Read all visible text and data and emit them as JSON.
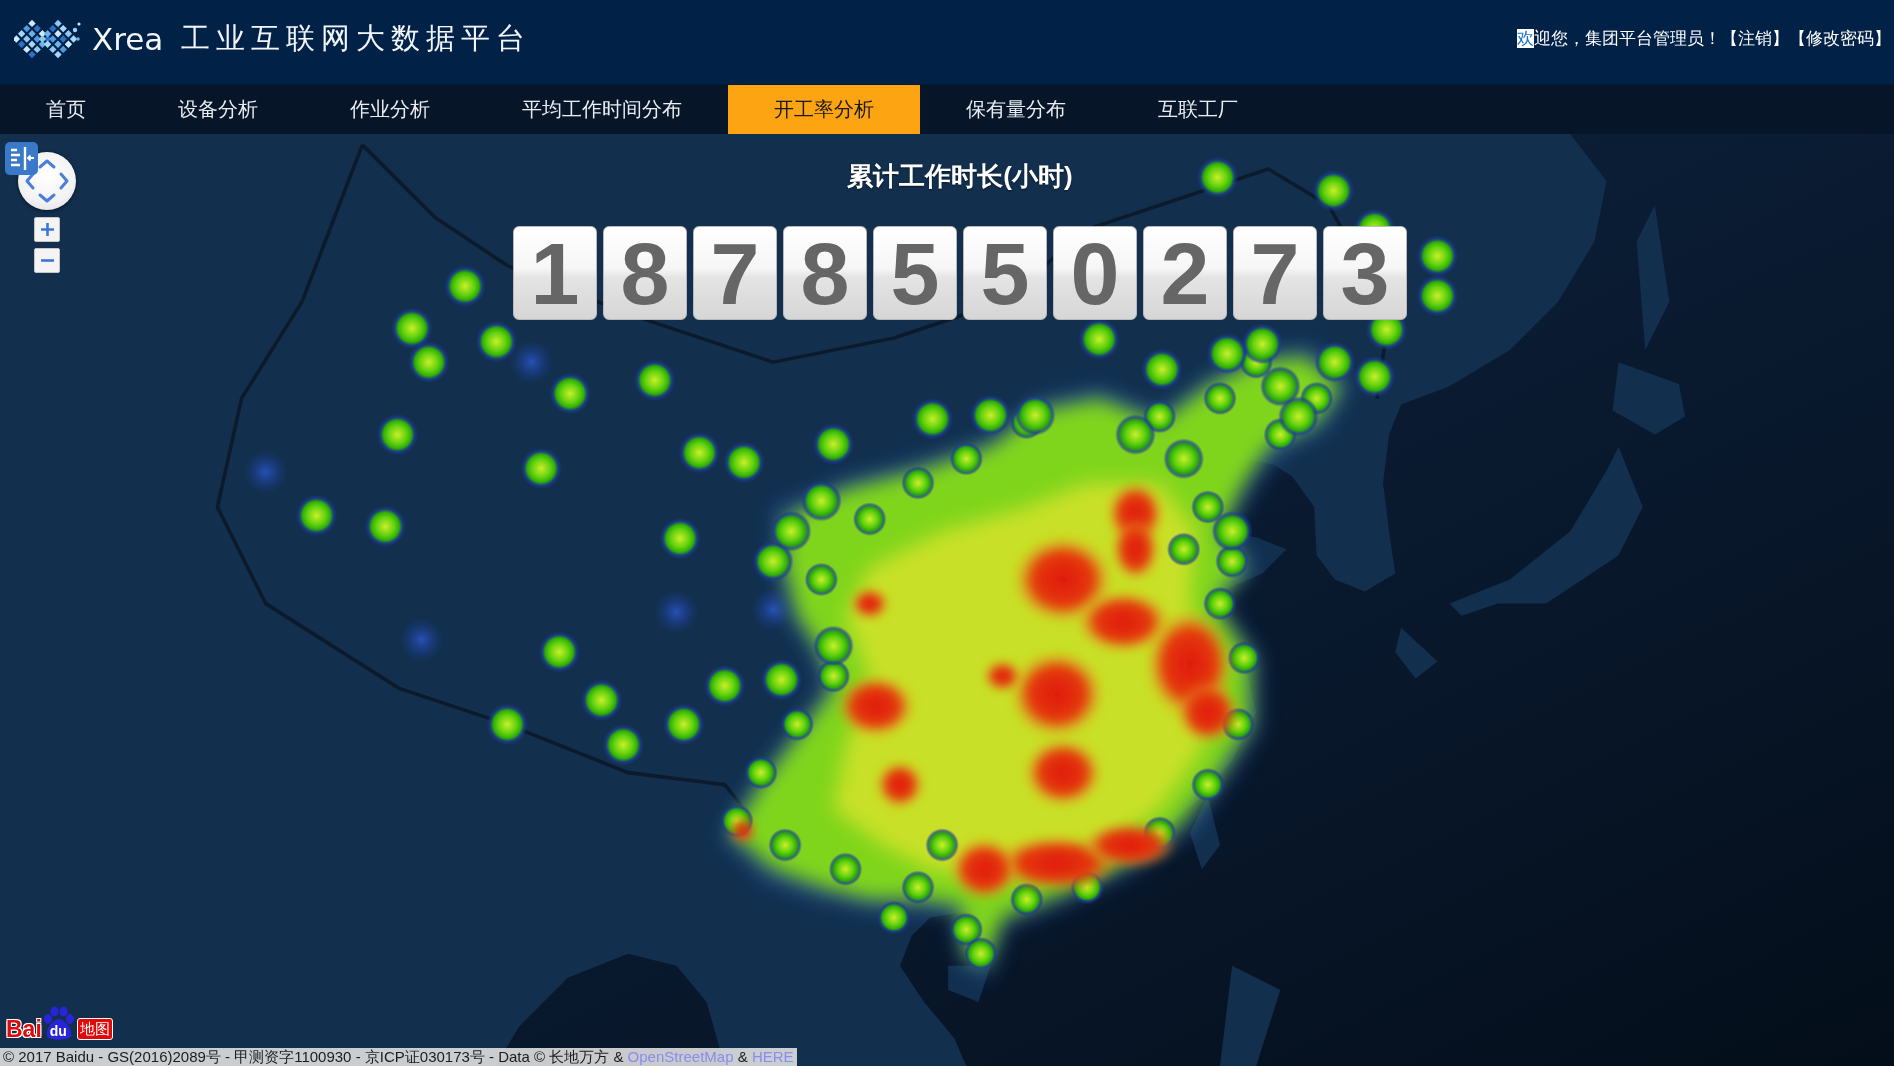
{
  "header": {
    "logo_text": "Xrea",
    "title": "工业互联网大数据平台",
    "welcome": {
      "highlighted": "欢",
      "text": "迎您，集团平台管理员！"
    },
    "links": [
      "【注销】",
      "【修改密码】"
    ]
  },
  "nav": {
    "items": [
      {
        "label": "首页",
        "selected": false
      },
      {
        "label": "设备分析",
        "selected": false
      },
      {
        "label": "作业分析",
        "selected": false
      },
      {
        "label": "平均工作时间分布",
        "selected": false
      },
      {
        "label": "开工率分析",
        "selected": true
      },
      {
        "label": "保有量分布",
        "selected": false
      },
      {
        "label": "互联工厂",
        "selected": false
      }
    ]
  },
  "counter": {
    "title": "累计工作时长(小时)",
    "digits": [
      "1",
      "8",
      "7",
      "8",
      "5",
      "5",
      "0",
      "2",
      "7",
      "3"
    ]
  },
  "map": {
    "logo": {
      "brand": "Bai",
      "paw_text": "du",
      "product": "地图"
    },
    "attribution": [
      {
        "kind": "text",
        "text": "© 2017 Baidu - GS(2016)2089号 - 甲测资字1100930 - 京ICP证030173号 - Data © 长地万方 &"
      },
      {
        "kind": "link",
        "text": "OpenStreetMap"
      },
      {
        "kind": "text",
        "text": "&"
      },
      {
        "kind": "link",
        "text": "HERE"
      }
    ]
  }
}
